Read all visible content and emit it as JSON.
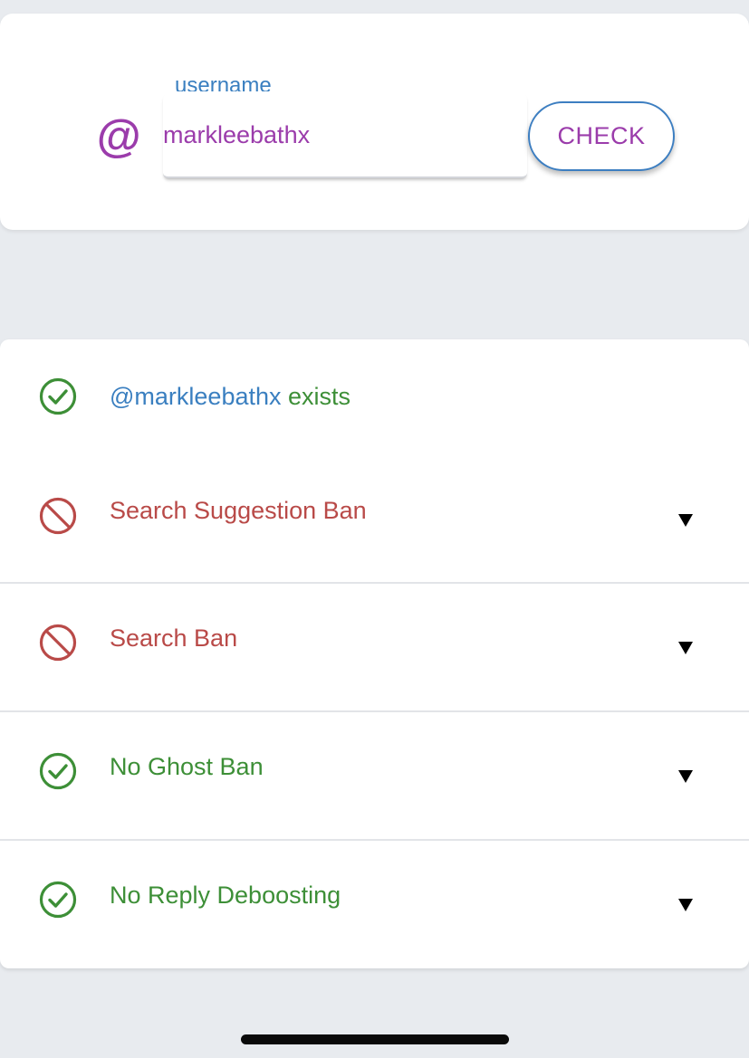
{
  "colors": {
    "background": "#e8ebef",
    "card": "#ffffff",
    "purple": "#9b3cab",
    "blue": "#3a7fc0",
    "green": "#3d8f37",
    "red": "#b94a48",
    "arrow": "#000000"
  },
  "search": {
    "at_symbol": "@",
    "label": "username",
    "value": "markleebathx",
    "button_label": "CHECK"
  },
  "results": {
    "exists": {
      "icon": "check-circle-icon",
      "handle": "@markleebathx",
      "suffix": "exists"
    },
    "items": [
      {
        "icon": "ban-icon",
        "status": "fail",
        "label": "Search Suggestion Ban",
        "arrow": "▼"
      },
      {
        "icon": "ban-icon",
        "status": "fail",
        "label": "Search Ban",
        "arrow": "▼"
      },
      {
        "icon": "check-circle-icon",
        "status": "pass",
        "label": "No Ghost Ban",
        "arrow": "▼"
      },
      {
        "icon": "check-circle-icon",
        "status": "pass",
        "label": "No Reply Deboosting",
        "arrow": "▼"
      }
    ]
  }
}
